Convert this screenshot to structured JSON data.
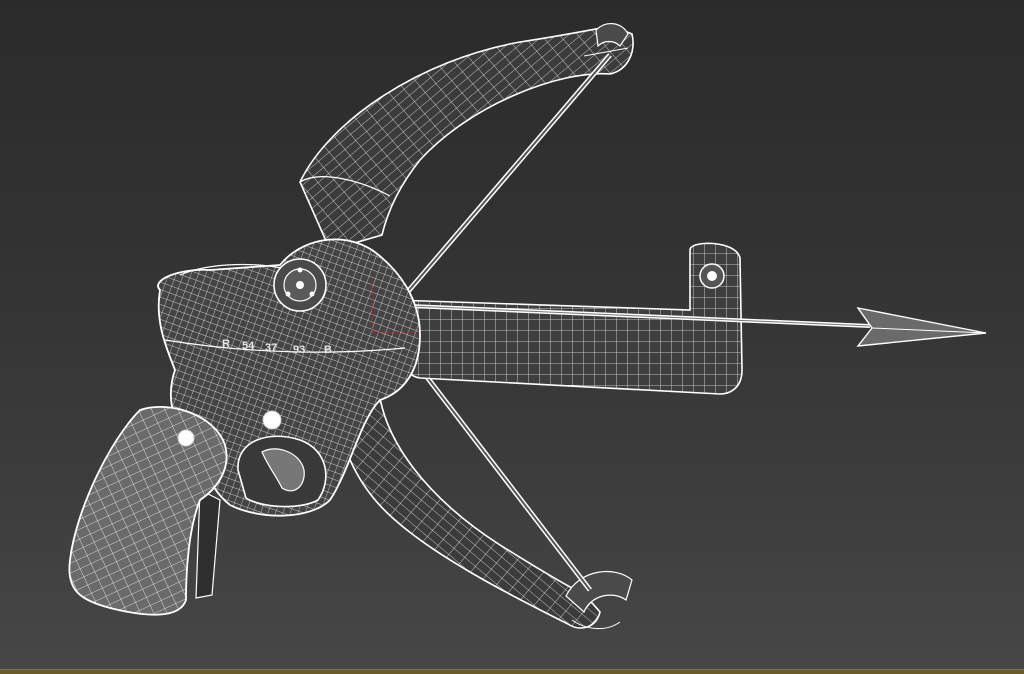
{
  "viewport": {
    "background_top": "#2b2b2b",
    "background_bottom": "#474747",
    "wire_color": "#ffffff",
    "selection_color": "#cc2222"
  },
  "model": {
    "engraving": {
      "prefix": "R",
      "n1": "54",
      "n2": "37",
      "n3": "93",
      "suffix": "B"
    }
  }
}
